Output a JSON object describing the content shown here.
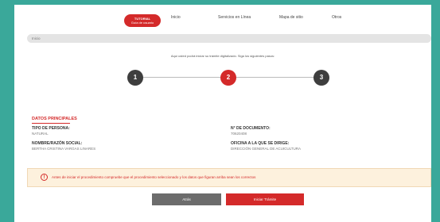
{
  "nav": {
    "active_line1": "TUTORIAL",
    "active_line2": "Guía de usuario",
    "items": [
      "Inicio",
      "Servicios en Línea",
      "Mapa de sitio",
      "Otros"
    ]
  },
  "search": {
    "placeholder": "Inicio"
  },
  "intro_text": "Aquí usted podrá iniciar su trámite digitalizado. Siga los siguientes pasos:",
  "stepper": {
    "steps": [
      "1",
      "2",
      "3"
    ],
    "active_step": 2
  },
  "datos": {
    "title": "DATOS PRINCIPALES",
    "tipo_persona_label": "TIPO DE PERSONA:",
    "tipo_persona_value": "NATURAL",
    "nombre_label": "NOMBRE/RAZÓN SOCIAL:",
    "nombre_value": "BERTHA CRISTINA VARGAS LINARES",
    "documento_label": "N° DE DOCUMENTO:",
    "documento_value": "70620408",
    "oficina_label": "OFICINA A LA QUE SE DIRIGE:",
    "oficina_value": "DIRECCIÓN GENERAL DE ACUICULTURA"
  },
  "warning": {
    "text": "Antes de iniciar el procedimiento compruebe que el procedimiento seleccionado y los datos que figuran arriba sean los correctos"
  },
  "buttons": {
    "back": "Atrás",
    "next": "Iniciar Trámite"
  },
  "colors": {
    "accent": "#d42a2a",
    "frame": "#3aa89a",
    "dark_step": "#3e3e3e"
  }
}
